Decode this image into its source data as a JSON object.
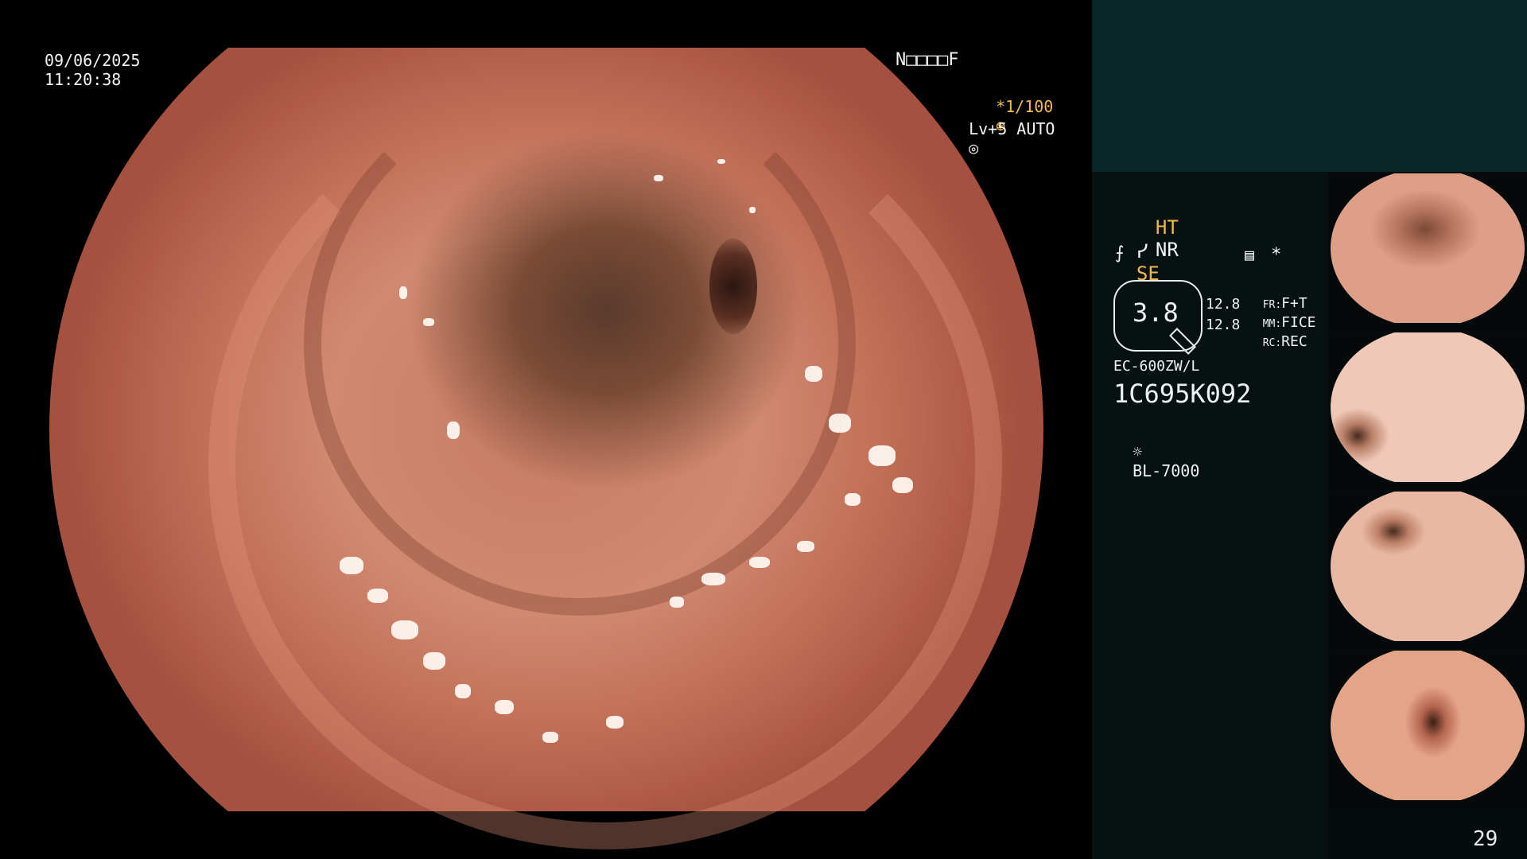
{
  "main_view": {
    "date": "09/06/2025",
    "time": "11:20:38",
    "code": "N□□□□F",
    "shutter": "*1/100",
    "shutter_icon": "aperture-icon",
    "level": "Lv+5 AUTO",
    "level_icon": "target-icon"
  },
  "panel": {
    "ht_label": "HT",
    "nr_label": "NR",
    "se_label": "SE",
    "enhance_icon": "enhance-icon",
    "fluor_icon": "fluorescence-icon",
    "memo_icon": "memo-icon",
    "asterisk": "*",
    "gauge_value": "3.8",
    "row1_value": "12.8",
    "row2_value": "12.8",
    "fr_label": "FR:",
    "fr_value": "F+T",
    "mm_label": "MM:",
    "mm_value": "FICE",
    "rc_label": "RC:",
    "rc_value": "REC",
    "scope_model": "EC-600ZW/L",
    "scope_serial": "1C695K092",
    "light_icon": "light-source-icon",
    "light_source": "BL-7000",
    "page_number": "29"
  },
  "colors": {
    "accent": "#f2b94a",
    "panel_bg": "#060c0c",
    "header_teal": "#0a2728"
  }
}
